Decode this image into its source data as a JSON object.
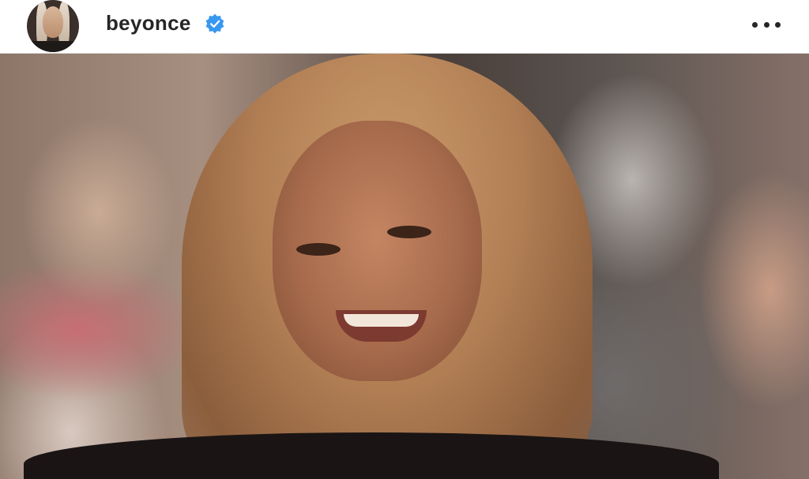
{
  "post": {
    "username": "beyonce",
    "verified": true,
    "more_icon": "more-horizontal-icon",
    "verified_icon": "verified-badge-icon",
    "avatar_icon": "profile-avatar",
    "accent_color": "#3897f0"
  }
}
